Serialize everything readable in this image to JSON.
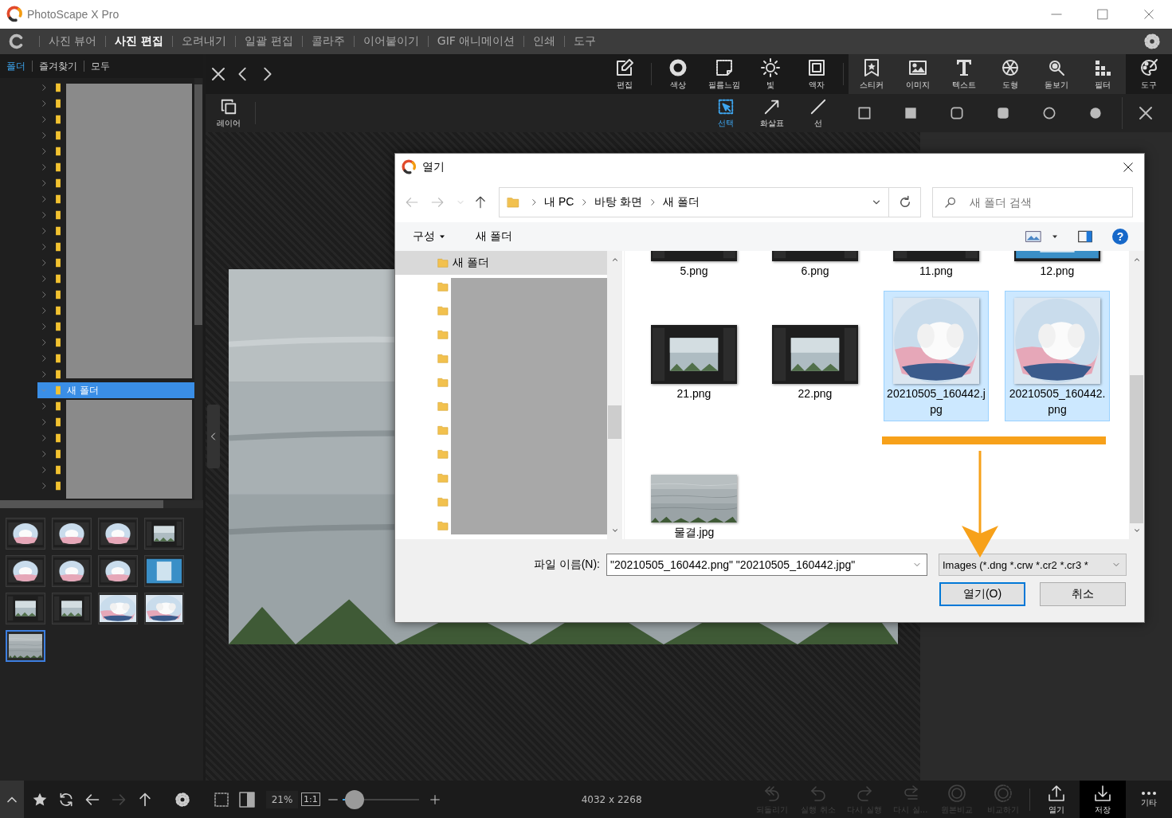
{
  "app": {
    "title": "PhotoScape X Pro"
  },
  "menu": [
    {
      "label": "사진 뷰어",
      "selected": false
    },
    {
      "label": "사진 편집",
      "selected": true
    },
    {
      "label": "오려내기",
      "selected": false
    },
    {
      "label": "일괄 편집",
      "selected": false
    },
    {
      "label": "콜라주",
      "selected": false
    },
    {
      "label": "이어붙이기",
      "selected": false
    },
    {
      "label": "GIF 애니메이션",
      "selected": false
    },
    {
      "label": "인쇄",
      "selected": false
    },
    {
      "label": "도구",
      "selected": false
    }
  ],
  "browser": {
    "tabs": [
      {
        "label": "폴더",
        "selected": true
      },
      {
        "label": "즐겨찾기",
        "selected": false
      },
      {
        "label": "모두",
        "selected": false
      }
    ],
    "tree": [
      {
        "selected": false
      },
      {
        "selected": false
      },
      {
        "selected": false
      },
      {
        "selected": false
      },
      {
        "selected": false
      },
      {
        "selected": false
      },
      {
        "selected": false
      },
      {
        "selected": false
      },
      {
        "selected": false
      },
      {
        "selected": false
      },
      {
        "selected": false
      },
      {
        "selected": false
      },
      {
        "selected": false
      },
      {
        "selected": false
      },
      {
        "selected": false
      },
      {
        "selected": false
      },
      {
        "selected": false
      },
      {
        "selected": false
      },
      {
        "selected": false
      },
      {
        "label": "새 폴더",
        "selected": true
      },
      {
        "selected": false
      },
      {
        "selected": false
      },
      {
        "selected": false
      },
      {
        "selected": false
      },
      {
        "selected": false
      },
      {
        "selected": false
      }
    ],
    "thumbnails": [
      {
        "selected": false
      },
      {
        "selected": false
      },
      {
        "selected": false
      },
      {
        "selected": false
      },
      {
        "selected": false
      },
      {
        "selected": false
      },
      {
        "selected": false
      },
      {
        "selected": false
      },
      {
        "selected": false
      },
      {
        "selected": false
      },
      {
        "selected": false
      },
      {
        "selected": false
      },
      {
        "selected": true
      }
    ],
    "toolbar": [
      {
        "disabled": false
      },
      {
        "disabled": false
      },
      {
        "disabled": false
      },
      {
        "disabled": false
      },
      {
        "disabled": true
      },
      {
        "disabled": false
      },
      {
        "disabled": false
      }
    ]
  },
  "editor": {
    "main_tools": [
      {
        "label": "편집"
      },
      {
        "label": "색상"
      },
      {
        "label": "필름느낌"
      },
      {
        "label": "빛"
      },
      {
        "label": "액자"
      }
    ],
    "object_tools": [
      {
        "label": "스티커"
      },
      {
        "label": "이미지"
      },
      {
        "label": "텍스트"
      },
      {
        "label": "도형"
      },
      {
        "label": "돋보기"
      },
      {
        "label": "필터"
      }
    ],
    "tools_button": "도구",
    "layer_button": "레이어",
    "draw_tools": [
      {
        "label": "선택",
        "selected": true
      },
      {
        "label": "화살표",
        "selected": false
      },
      {
        "label": "선",
        "selected": false
      }
    ]
  },
  "status_bar": {
    "zoom": "21%",
    "actual_size": "1:1",
    "zoom_slider": {
      "level": 0.1
    },
    "dimensions": "4032 x 2268",
    "actions": [
      {
        "label": "되돌리기",
        "disabled": true,
        "highlighted": false
      },
      {
        "label": "실행 취소",
        "disabled": true,
        "highlighted": false
      },
      {
        "label": "다시 실행",
        "disabled": true,
        "highlighted": false
      },
      {
        "label": "다시 실…",
        "disabled": true,
        "highlighted": false
      },
      {
        "label": "원본비교",
        "disabled": true,
        "highlighted": false
      },
      {
        "label": "비교하기",
        "disabled": true,
        "highlighted": false
      },
      {
        "label": "열기",
        "disabled": false,
        "highlighted": false
      },
      {
        "label": "저장",
        "disabled": false,
        "highlighted": true
      },
      {
        "label": "기타",
        "disabled": false,
        "highlighted": false
      }
    ]
  },
  "dialog": {
    "title": "열기",
    "breadcrumb": [
      "내 PC",
      "바탕 화면",
      "새 폴더"
    ],
    "search": {
      "placeholder": "새 폴더 검색"
    },
    "commands": [
      "구성",
      "새 폴더"
    ],
    "help": "?",
    "nav": [
      {
        "label": "새 폴더",
        "selected": true
      },
      {
        "selected": false
      },
      {
        "selected": false
      },
      {
        "selected": false
      },
      {
        "selected": false
      },
      {
        "selected": false
      },
      {
        "selected": false
      },
      {
        "selected": false
      },
      {
        "selected": false
      },
      {
        "selected": false
      },
      {
        "selected": false
      },
      {
        "selected": false
      }
    ],
    "files": [
      {
        "name": "5.png",
        "selected": false
      },
      {
        "name": "6.png",
        "selected": false
      },
      {
        "name": "11.png",
        "selected": false
      },
      {
        "name": "12.png",
        "selected": false
      },
      {
        "name": "21.png",
        "selected": false
      },
      {
        "name": "22.png",
        "selected": false
      },
      {
        "name": "20210505_160442.jpg",
        "selected": true
      },
      {
        "name": "20210505_160442.png",
        "selected": true
      },
      {
        "name": "물결.jpg",
        "selected": false
      }
    ],
    "file_name_label": "파일 이름(N):",
    "file_name": "\"20210505_160442.png\" \"20210505_160442.jpg\"",
    "file_type": "Images (*.dng *.crw *.cr2 *.cr3 *",
    "buttons": [
      {
        "label": "열기(O)",
        "default": true
      },
      {
        "label": "취소",
        "default": false
      }
    ]
  }
}
